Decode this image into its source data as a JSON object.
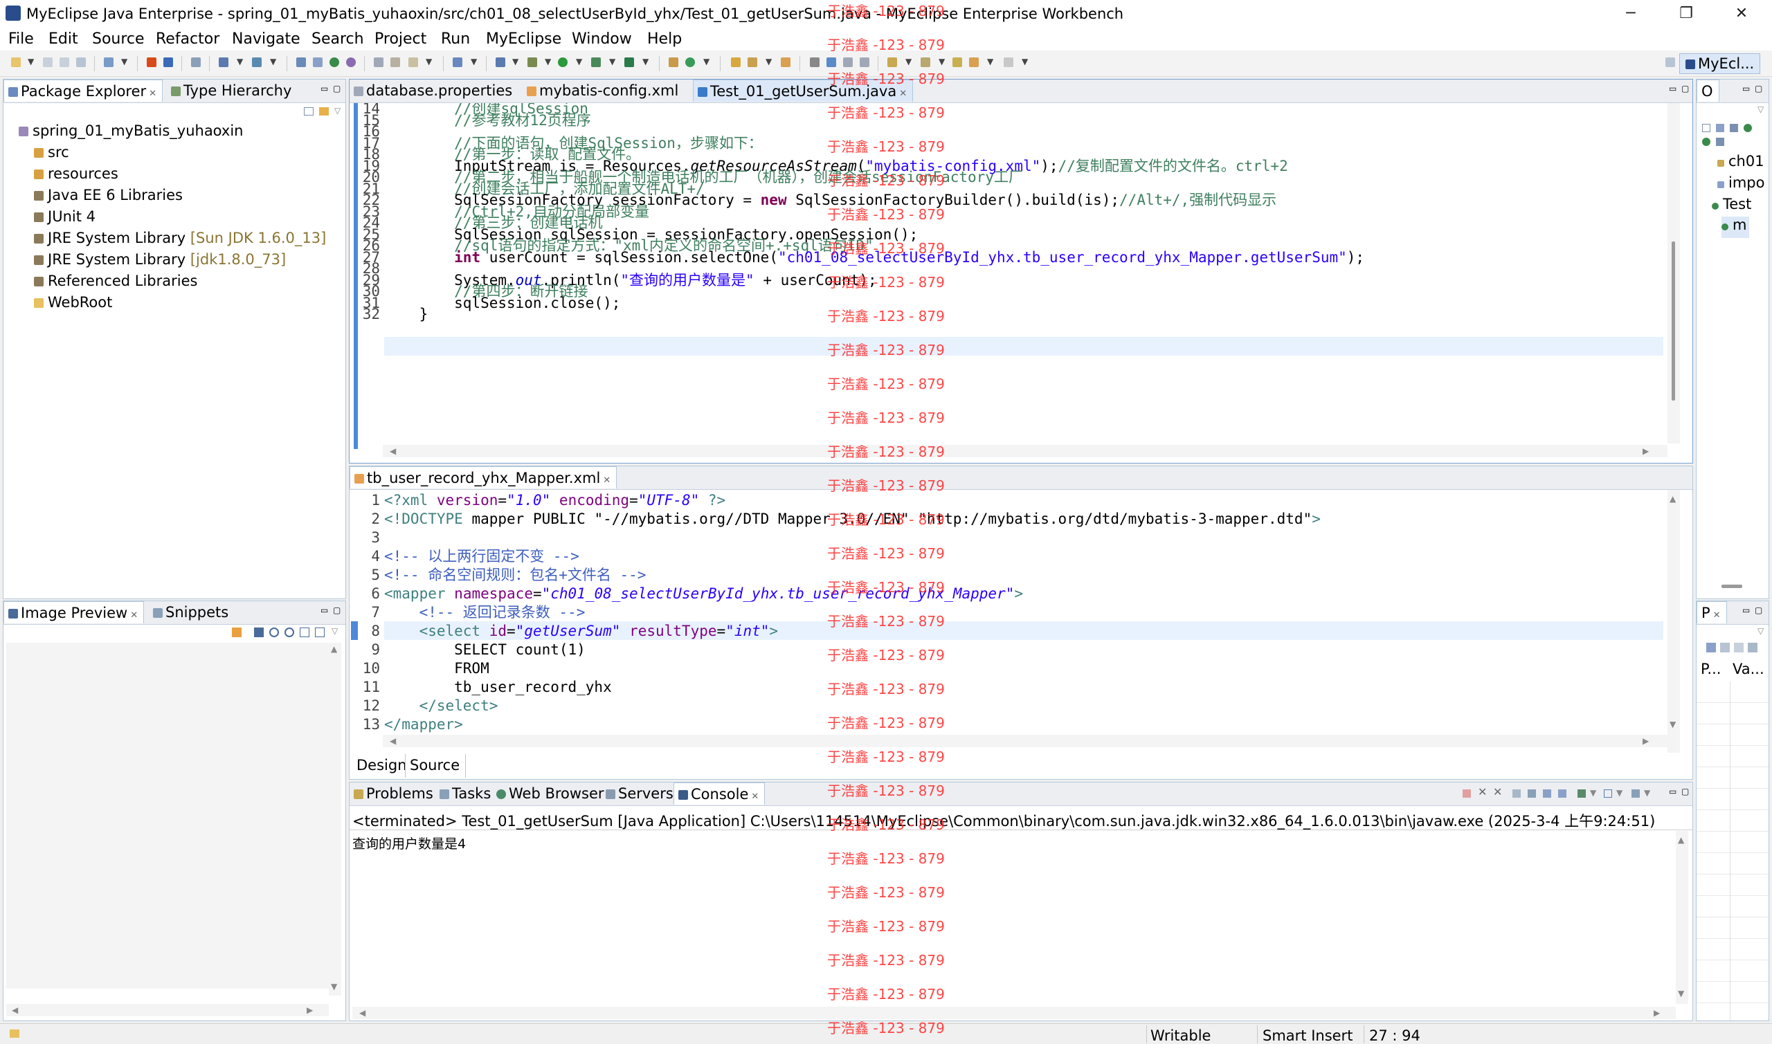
{
  "window": {
    "title": "MyEclipse Java Enterprise - spring_01_myBatis_yuhaoxin/src/ch01_08_selectUserById_yhx/Test_01_getUserSum.java - MyEclipse Enterprise Workbench",
    "minimize": "─",
    "restore": "❐",
    "close": "✕"
  },
  "menu": [
    "File",
    "Edit",
    "Source",
    "Refactor",
    "Navigate",
    "Search",
    "Project",
    "Run",
    "MyEclipse",
    "Window",
    "Help"
  ],
  "perspective": {
    "label": "MyEcl..."
  },
  "package_explorer": {
    "tabs": [
      "Package Explorer",
      "Type Hierarchy"
    ],
    "project": "spring_01_myBatis_yuhaoxin",
    "items": [
      {
        "label": "src",
        "extra": ""
      },
      {
        "label": "resources",
        "extra": ""
      },
      {
        "label": "Java EE 6 Libraries",
        "extra": ""
      },
      {
        "label": "JUnit 4",
        "extra": ""
      },
      {
        "label": "JRE System Library",
        "extra": "[Sun JDK 1.6.0_13]"
      },
      {
        "label": "JRE System Library",
        "extra": "[jdk1.8.0_73]"
      },
      {
        "label": "Referenced Libraries",
        "extra": ""
      },
      {
        "label": "WebRoot",
        "extra": ""
      }
    ]
  },
  "image_preview": {
    "tabs": [
      "Image Preview",
      "Snippets"
    ]
  },
  "editor": {
    "tabs": [
      "database.properties",
      "mybatis-config.xml",
      "Test_01_getUserSum.java"
    ],
    "lines": [
      {
        "n": "14",
        "t": "        //创建sqlSession"
      },
      {
        "n": "15",
        "t": "        //参考教材12页程序"
      },
      {
        "n": "16",
        "t": ""
      },
      {
        "n": "17",
        "t": "        //下面的语句，创建SqlSession，步骤如下："
      },
      {
        "n": "18",
        "t": "        //第一步：读取 配置文件。"
      },
      {
        "n": "19",
        "t": "        InputStream is = Resources.getResourceAsStream(\"mybatis-config.xml\");//复制配置文件的文件名。ctrl+2"
      },
      {
        "n": "20",
        "t": "        //第二步，相当于船舰一个制造电话机的工厂（机器），创建会话sessionFactory工厂"
      },
      {
        "n": "21",
        "t": "        //创建会话工厂，添加配置文件ALT+/"
      },
      {
        "n": "22",
        "t": "        SqlSessionFactory sessionFactory = new SqlSessionFactoryBuilder().build(is);//Alt+/,强制代码显示"
      },
      {
        "n": "23",
        "t": "        //Ctrl+2,自动分配局部变量"
      },
      {
        "n": "24",
        "t": "        //第三步：创建电话机"
      },
      {
        "n": "25",
        "t": "        SqlSession sqlSession = sessionFactory.openSession();"
      },
      {
        "n": "26",
        "t": "        //sql语句的指定方式：\"xml内定义的命名空间+.+sql语句ID\""
      },
      {
        "n": "27",
        "t": "        int userCount = sqlSession.selectOne(\"ch01_08_selectUserById_yhx.tb_user_record_yhx_Mapper.getUserSum\");"
      },
      {
        "n": "28",
        "t": ""
      },
      {
        "n": "29",
        "t": "        System.out.println(\"查询的用户数量是\" + userCount);"
      },
      {
        "n": "30",
        "t": "        //第四步：断开链接"
      },
      {
        "n": "31",
        "t": "        sqlSession.close();"
      },
      {
        "n": "32",
        "t": "    }"
      }
    ]
  },
  "xml_editor": {
    "tab": "tb_user_record_yhx_Mapper.xml",
    "lines": [
      {
        "n": "1",
        "t": "<?xml version=\"1.0\" encoding=\"UTF-8\" ?>"
      },
      {
        "n": "2",
        "t": "<!DOCTYPE mapper PUBLIC \"-//mybatis.org//DTD Mapper 3.0//EN\" \"http://mybatis.org/dtd/mybatis-3-mapper.dtd\">"
      },
      {
        "n": "3",
        "t": ""
      },
      {
        "n": "4",
        "t": "<!-- 以上两行固定不变 -->"
      },
      {
        "n": "5",
        "t": "<!-- 命名空间规则：包名+文件名 -->"
      },
      {
        "n": "6",
        "t": "<mapper namespace=\"ch01_08_selectUserById_yhx.tb_user_record_yhx_Mapper\">"
      },
      {
        "n": "7",
        "t": "    <!-- 返回记录条数 -->"
      },
      {
        "n": "8",
        "t": "    <select id=\"getUserSum\" resultType=\"int\">"
      },
      {
        "n": "9",
        "t": "        SELECT count(1)"
      },
      {
        "n": "10",
        "t": "        FROM"
      },
      {
        "n": "11",
        "t": "        tb_user_record_yhx"
      },
      {
        "n": "12",
        "t": "    </select>"
      },
      {
        "n": "13",
        "t": "</mapper>"
      }
    ],
    "bottom_tabs": [
      "Design",
      "Source"
    ]
  },
  "console": {
    "tabs": [
      "Problems",
      "Tasks",
      "Web Browser",
      "Servers",
      "Console"
    ],
    "header": "<terminated> Test_01_getUserSum [Java Application] C:\\Users\\114514\\MyEclipse\\Common\\binary\\com.sun.java.jdk.win32.x86_64_1.6.0.013\\bin\\javaw.exe (2025-3-4 上午9:24:51)",
    "output": "查询的用户数量是4"
  },
  "outline": {
    "tab": "O",
    "items": [
      "ch01",
      "impo",
      "Test",
      "m"
    ]
  },
  "properties": {
    "tab": "P",
    "cols": [
      "P...",
      "Va..."
    ]
  },
  "watermark": {
    "text": "于浩鑫 -123 - 879"
  },
  "status": {
    "mode": "Writable",
    "insert": "Smart Insert",
    "position": "27 : 94"
  },
  "colors": {
    "keyword": "#7f0055",
    "string": "#2a00ff",
    "comment": "#3f7f5f",
    "watermark": "#ff2d2d",
    "active_tab_bg": "#ffffff",
    "highlight_line": "#e8f2fe"
  }
}
